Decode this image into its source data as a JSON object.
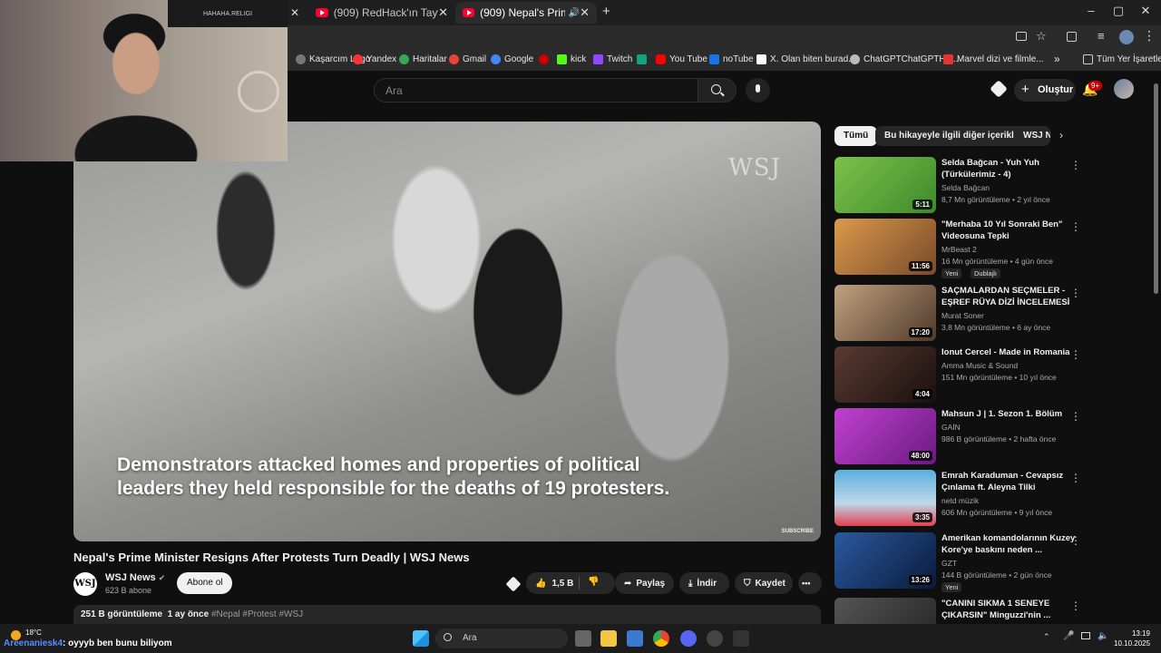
{
  "browser": {
    "tabs": [
      {
        "label": "(909) RedHack'ın Tayyip İçin Ya..."
      },
      {
        "label": "(909) Nepal's Prime Ministe..."
      }
    ],
    "new_tab": "+",
    "close": "✕",
    "window_controls": {
      "minimize": "–",
      "maximize": "▢",
      "close": "✕"
    },
    "bookmarks": [
      {
        "label": "Kaşarcım Logo",
        "color": "#777777"
      },
      {
        "label": "Yandex",
        "color": "#ff3333"
      },
      {
        "label": "Haritalar",
        "color": "#34a853"
      },
      {
        "label": "Gmail",
        "color": "#ea4335"
      },
      {
        "label": "Google",
        "color": "#4285f4"
      },
      {
        "label": "",
        "color": "#cc0000"
      },
      {
        "label": "kick",
        "color": "#53fc18"
      },
      {
        "label": "Twitch",
        "color": "#9146ff"
      },
      {
        "label": "",
        "color": "#10a37f"
      },
      {
        "label": "You Tube",
        "color": "#ff0000"
      },
      {
        "label": "noTube",
        "color": "#1a73e8"
      },
      {
        "label": "X. Olan biten burad...",
        "color": "#ffffff"
      },
      {
        "label": "ChatGPTChatGPTHtt...",
        "color": "#bbbbbb"
      },
      {
        "label": "Marvel dizi ve filmle...",
        "color": "#e23636"
      }
    ],
    "bookmarks_overflow": "»",
    "all_bookmarks": "Tüm Yer İşaretleri"
  },
  "youtube": {
    "search_placeholder": "Ara",
    "create_label": "Oluştur",
    "notif_count": "9+",
    "player": {
      "watermark": "WSJ",
      "caption": "Demonstrators attacked homes and properties of political leaders they held responsible for the deaths of 19 protesters.",
      "subscribe_small": "SUBSCRIBE"
    },
    "video_title": "Nepal's Prime Minister Resigns After Protests Turn Deadly | WSJ News",
    "channel": {
      "logo": "WSJ",
      "name": "WSJ News",
      "subs": "623 B abone",
      "subscribe": "Abone ol"
    },
    "actions": {
      "likes": "1,5 B",
      "share": "Paylaş",
      "download": "İndir",
      "save": "Kaydet",
      "more": "•••"
    },
    "description": {
      "stats": "251 B görüntüleme  1 ay önce",
      "tags": "#Nepal #Protest #WSJ"
    },
    "chips": [
      "Tümü",
      "Bu hikayeyle ilgili diğer içerikler",
      "WSJ N"
    ],
    "recommendations": [
      {
        "title": "Selda Bağcan - Yuh Yuh (Türkülerimiz - 4)",
        "channel": "Selda Bağcan",
        "meta": "8,7 Mn görüntüleme • 2 yıl önce",
        "duration": "5:11",
        "thumb": "#5aa03a"
      },
      {
        "title": "\"Merhaba 10 Yıl Sonraki Ben\" Videosuna Tepki",
        "channel": "MrBeast 2",
        "meta": "16 Mn görüntüleme • 4 gün önce",
        "duration": "11:56",
        "thumb": "#c8863a",
        "badge": "Yeni",
        "badge2": "Dublajlı"
      },
      {
        "title": "SAÇMALARDAN SEÇMELER - EŞREF RÜYA DİZİ İNCELEMESİ",
        "channel": "Murat Soner",
        "meta": "3,8 Mn görüntüleme • 6 ay önce",
        "duration": "17:20",
        "thumb": "#8a6a52"
      },
      {
        "title": "Ionut Cercel - Made in Romania",
        "channel": "Amma Music & Sound",
        "meta": "151 Mn görüntüleme • 10 yıl önce",
        "duration": "4:04",
        "thumb": "#3a2a24"
      },
      {
        "title": "Mahsun J | 1. Sezon 1. Bölüm",
        "channel": "GAİN",
        "meta": "986 B görüntüleme • 2 hafta önce",
        "duration": "48:00",
        "thumb": "#a030b0"
      },
      {
        "title": "Emrah Karaduman - Cevapsız Çınlama ft. Aleyna Tilki",
        "channel": "netd müzik",
        "meta": "606 Mn görüntüleme • 9 yıl önce",
        "duration": "3:35",
        "thumb": "#2a8fc0"
      },
      {
        "title": "Amerikan komandolarının Kuzey Kore'ye baskını neden ...",
        "channel": "GZT",
        "meta": "144 B görüntüleme • 2 gün önce",
        "duration": "13:26",
        "thumb": "#1f3f7a",
        "badge": "Yeni"
      },
      {
        "title": "\"CANINI SIKMA 1 SENEYE ÇIKARSIN\" Minguzzi'nin ...",
        "channel": "",
        "meta": "",
        "duration": "",
        "thumb": "#444444"
      }
    ]
  },
  "webcam": {
    "poster_text": "HAHAHA.RELIGI"
  },
  "taskbar": {
    "weather_temp": "18°C",
    "search_placeholder": "Ara",
    "chat_user": "Areenaniesk4",
    "chat_message": ": oyyyb ben bunu biliyom",
    "time": "13:19",
    "date": "10.10.2025"
  }
}
